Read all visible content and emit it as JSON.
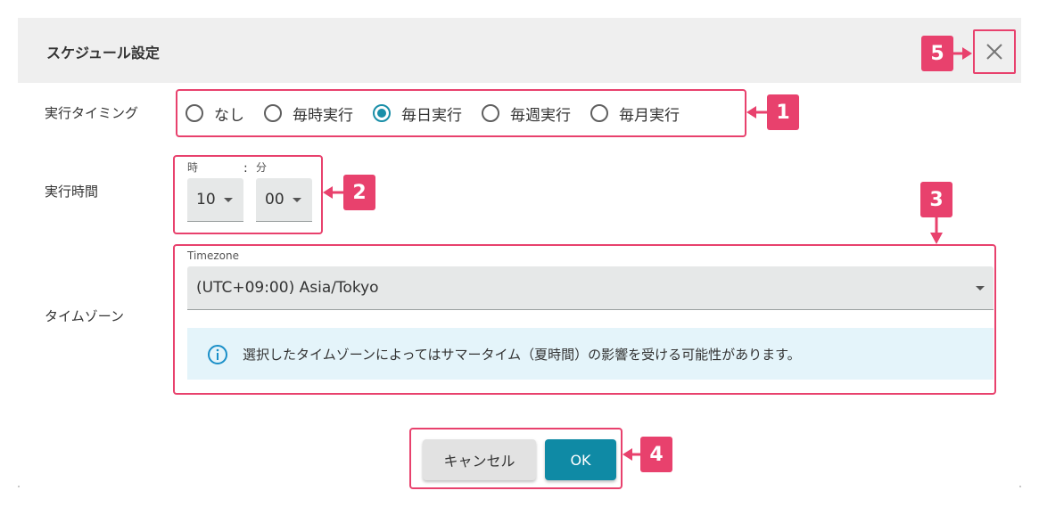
{
  "dialog": {
    "title": "スケジュール設定",
    "close_icon": "close-icon"
  },
  "timing": {
    "label": "実行タイミング",
    "options": [
      "なし",
      "毎時実行",
      "毎日実行",
      "毎週実行",
      "毎月実行"
    ],
    "selected": "毎日実行"
  },
  "time": {
    "label": "実行時間",
    "hour_label": "時",
    "separator": ":",
    "minute_label": "分",
    "hour_value": "10",
    "minute_value": "00"
  },
  "timezone": {
    "label": "タイムゾーン",
    "field_label": "Timezone",
    "value": "(UTC+09:00) Asia/Tokyo",
    "info_icon": "info-icon",
    "info_text": "選択したタイムゾーンによってはサマータイム（夏時間）の影響を受ける可能性があります。"
  },
  "buttons": {
    "cancel": "キャンセル",
    "ok": "OK"
  },
  "annotations": {
    "badges": [
      "1",
      "2",
      "3",
      "4",
      "5"
    ],
    "color": "#e8416d"
  },
  "colors": {
    "accent": "#1a8fa8",
    "ok_button": "#0f8aa5",
    "header_bg": "#efefef",
    "info_bg": "#e4f4fa"
  }
}
